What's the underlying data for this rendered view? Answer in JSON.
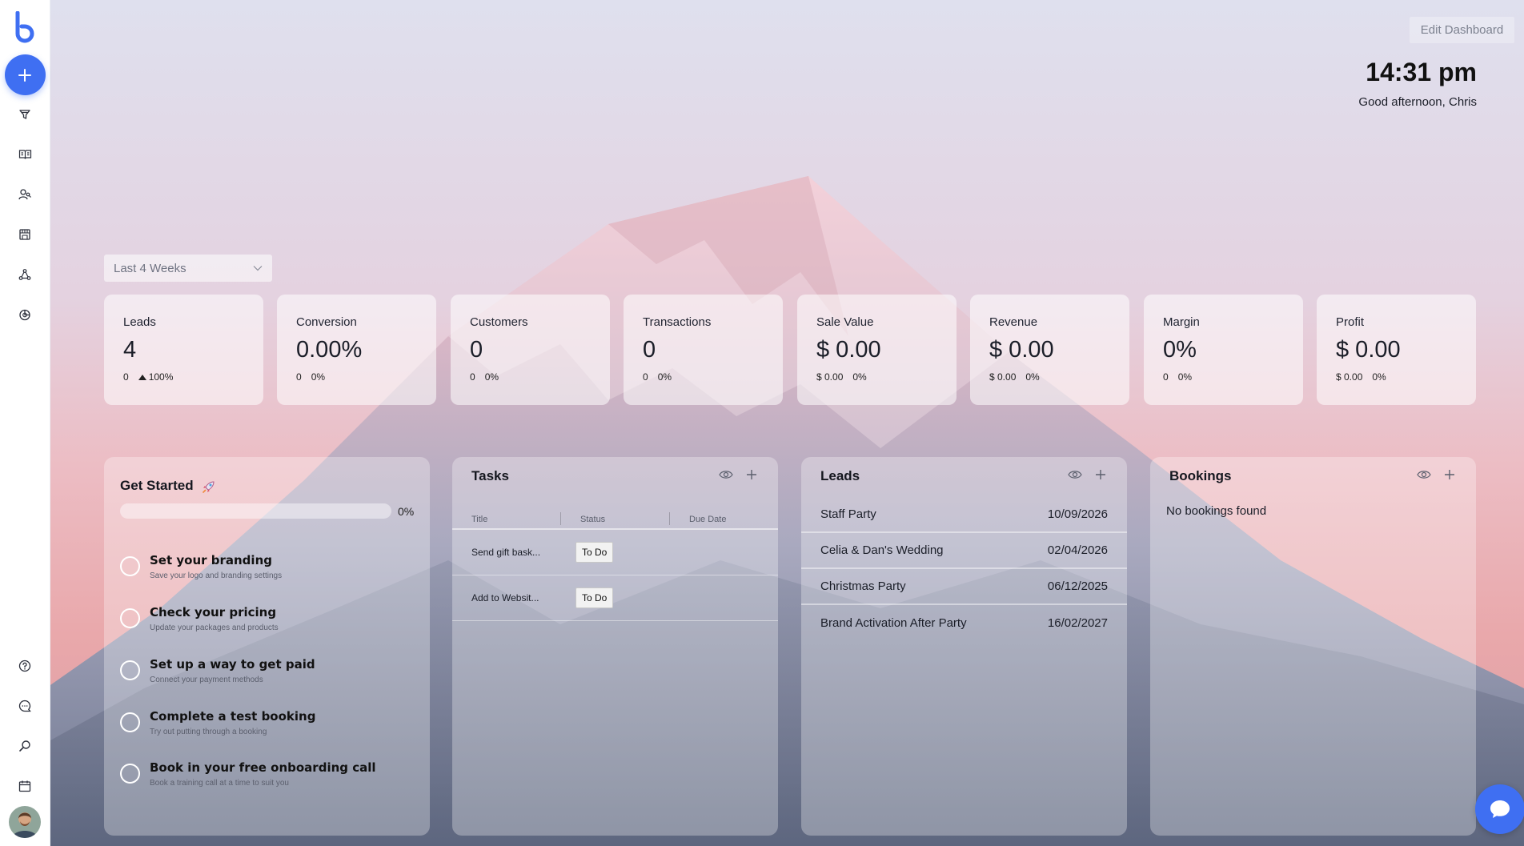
{
  "header": {
    "edit_button": "Edit Dashboard",
    "time": "14:31 pm",
    "greeting": "Good afternoon, Chris"
  },
  "filters": {
    "date_range": "Last 4 Weeks"
  },
  "sidebar": {
    "nav_top": [
      "funnel-icon",
      "book-icon",
      "contacts-icon",
      "store-icon",
      "network-icon",
      "reports-icon"
    ],
    "nav_bottom": [
      "help-icon",
      "chat-icon",
      "search-icon",
      "calendar-icon"
    ]
  },
  "stats": [
    {
      "label": "Leads",
      "value": "4",
      "sub1": "0",
      "sub2": "100%",
      "trend": "up"
    },
    {
      "label": "Conversion",
      "value": "0.00%",
      "sub1": "0",
      "sub2": "0%"
    },
    {
      "label": "Customers",
      "value": "0",
      "sub1": "0",
      "sub2": "0%"
    },
    {
      "label": "Transactions",
      "value": "0",
      "sub1": "0",
      "sub2": "0%"
    },
    {
      "label": "Sale Value",
      "value": "$ 0.00",
      "sub1": "$ 0.00",
      "sub2": "0%"
    },
    {
      "label": "Revenue",
      "value": "$ 0.00",
      "sub1": "$ 0.00",
      "sub2": "0%"
    },
    {
      "label": "Margin",
      "value": "0%",
      "sub1": "0",
      "sub2": "0%"
    },
    {
      "label": "Profit",
      "value": "$ 0.00",
      "sub1": "$ 0.00",
      "sub2": "0%"
    }
  ],
  "get_started": {
    "title": "Get Started",
    "progress_percent": 0,
    "progress_label": "0%",
    "items": [
      {
        "title": "Set your branding",
        "desc": "Save your logo and branding settings"
      },
      {
        "title": "Check your pricing",
        "desc": "Update your packages and products"
      },
      {
        "title": "Set up a way to get paid",
        "desc": "Connect your payment methods"
      },
      {
        "title": "Complete a test booking",
        "desc": "Try out putting through a booking"
      },
      {
        "title": "Book in your free onboarding call",
        "desc": "Book a training call at a time to suit you"
      }
    ]
  },
  "tasks": {
    "title": "Tasks",
    "columns": [
      "Title",
      "Status",
      "Due Date"
    ],
    "rows": [
      {
        "title": "Send gift bask...",
        "status": "To Do"
      },
      {
        "title": "Add to Websit...",
        "status": "To Do"
      }
    ]
  },
  "leads": {
    "title": "Leads",
    "rows": [
      {
        "name": "Staff Party",
        "date": "10/09/2026"
      },
      {
        "name": "Celia & Dan's Wedding",
        "date": "02/04/2026"
      },
      {
        "name": "Christmas Party",
        "date": "06/12/2025"
      },
      {
        "name": "Brand Activation After Party",
        "date": "16/02/2027"
      }
    ]
  },
  "bookings": {
    "title": "Bookings",
    "empty_text": "No bookings found"
  },
  "colors": {
    "accent": "#3f6ff2"
  }
}
